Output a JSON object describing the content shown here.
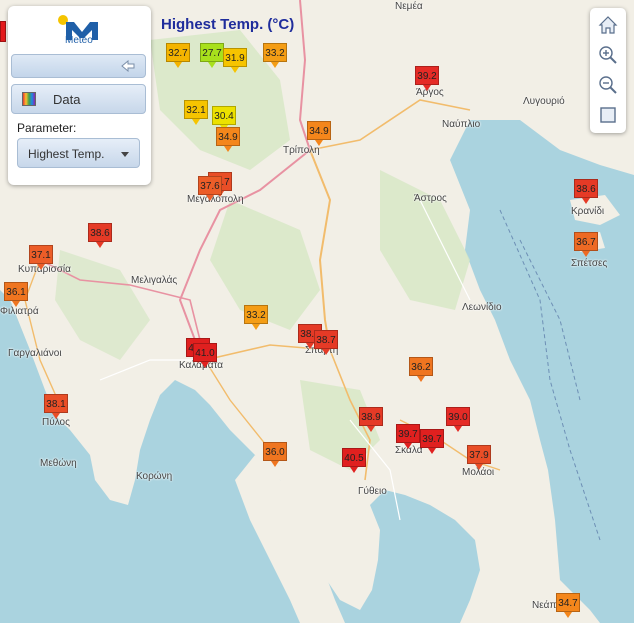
{
  "title": "Highest Temp. (°C)",
  "logo_text": "Meteo",
  "panel": {
    "data_label": "Data",
    "parameter_label": "Parameter:",
    "parameter_value": "Highest Temp."
  },
  "places": [
    {
      "name": "Νεμέα"
    },
    {
      "name": "Άργος"
    },
    {
      "name": "Λυγουριό"
    },
    {
      "name": "Ναύπλιο"
    },
    {
      "name": "Τρίπολη"
    },
    {
      "name": "Μεγαλόπολη"
    },
    {
      "name": "Άστρος"
    },
    {
      "name": "Κρανίδι"
    },
    {
      "name": "Σπέτσες"
    },
    {
      "name": "Κυπαρισσία"
    },
    {
      "name": "Μελιγαλάς"
    },
    {
      "name": "Φιλιατρά"
    },
    {
      "name": "Λεωνίδιο"
    },
    {
      "name": "Γαργαλιάνοι"
    },
    {
      "name": "Σπάρτη"
    },
    {
      "name": "Καλαμάτα"
    },
    {
      "name": "Πύλος"
    },
    {
      "name": "Σκάλα"
    },
    {
      "name": "Μολάοι"
    },
    {
      "name": "Μεθώνη"
    },
    {
      "name": "Κορώνη"
    },
    {
      "name": "Γύθειο"
    },
    {
      "name": "Νεάπ"
    }
  ],
  "stations": [
    {
      "value": "32.7",
      "color": "#f4b400"
    },
    {
      "value": "27.7",
      "color": "#a8e01c"
    },
    {
      "value": "31.9",
      "color": "#f6c400"
    },
    {
      "value": "33.2",
      "color": "#f49d15"
    },
    {
      "value": "39.2",
      "color": "#e52b26"
    },
    {
      "value": "32.1",
      "color": "#f6c400"
    },
    {
      "value": "30.4",
      "color": "#ece100"
    },
    {
      "value": "34.9",
      "color": "#f4861b"
    },
    {
      "value": "34.9",
      "color": "#f4861b"
    },
    {
      "value": "37.7",
      "color": "#e94e27"
    },
    {
      "value": "37.6",
      "color": "#ec5d28"
    },
    {
      "value": "38.6",
      "color": "#e53a26"
    },
    {
      "value": "36.7",
      "color": "#ed6a24"
    },
    {
      "value": "38.6",
      "color": "#e53a26"
    },
    {
      "value": "37.1",
      "color": "#ec5d28"
    },
    {
      "value": "36.1",
      "color": "#ef7520"
    },
    {
      "value": "33.2",
      "color": "#f49d15"
    },
    {
      "value": "38.8",
      "color": "#e53a26"
    },
    {
      "value": "38.7",
      "color": "#e53a26"
    },
    {
      "value": "40.2",
      "color": "#e0201f"
    },
    {
      "value": "41.0",
      "color": "#e0201f"
    },
    {
      "value": "36.2",
      "color": "#ef7520"
    },
    {
      "value": "38.1",
      "color": "#e94e27"
    },
    {
      "value": "38.9",
      "color": "#e53a26"
    },
    {
      "value": "39.0",
      "color": "#e52b26"
    },
    {
      "value": "39.7",
      "color": "#e0201f"
    },
    {
      "value": "39.7",
      "color": "#e0201f"
    },
    {
      "value": "37.9",
      "color": "#e94e27"
    },
    {
      "value": "36.0",
      "color": "#ef7520"
    },
    {
      "value": "40.5",
      "color": "#e0201f"
    },
    {
      "value": "34.7",
      "color": "#f4861b"
    }
  ]
}
